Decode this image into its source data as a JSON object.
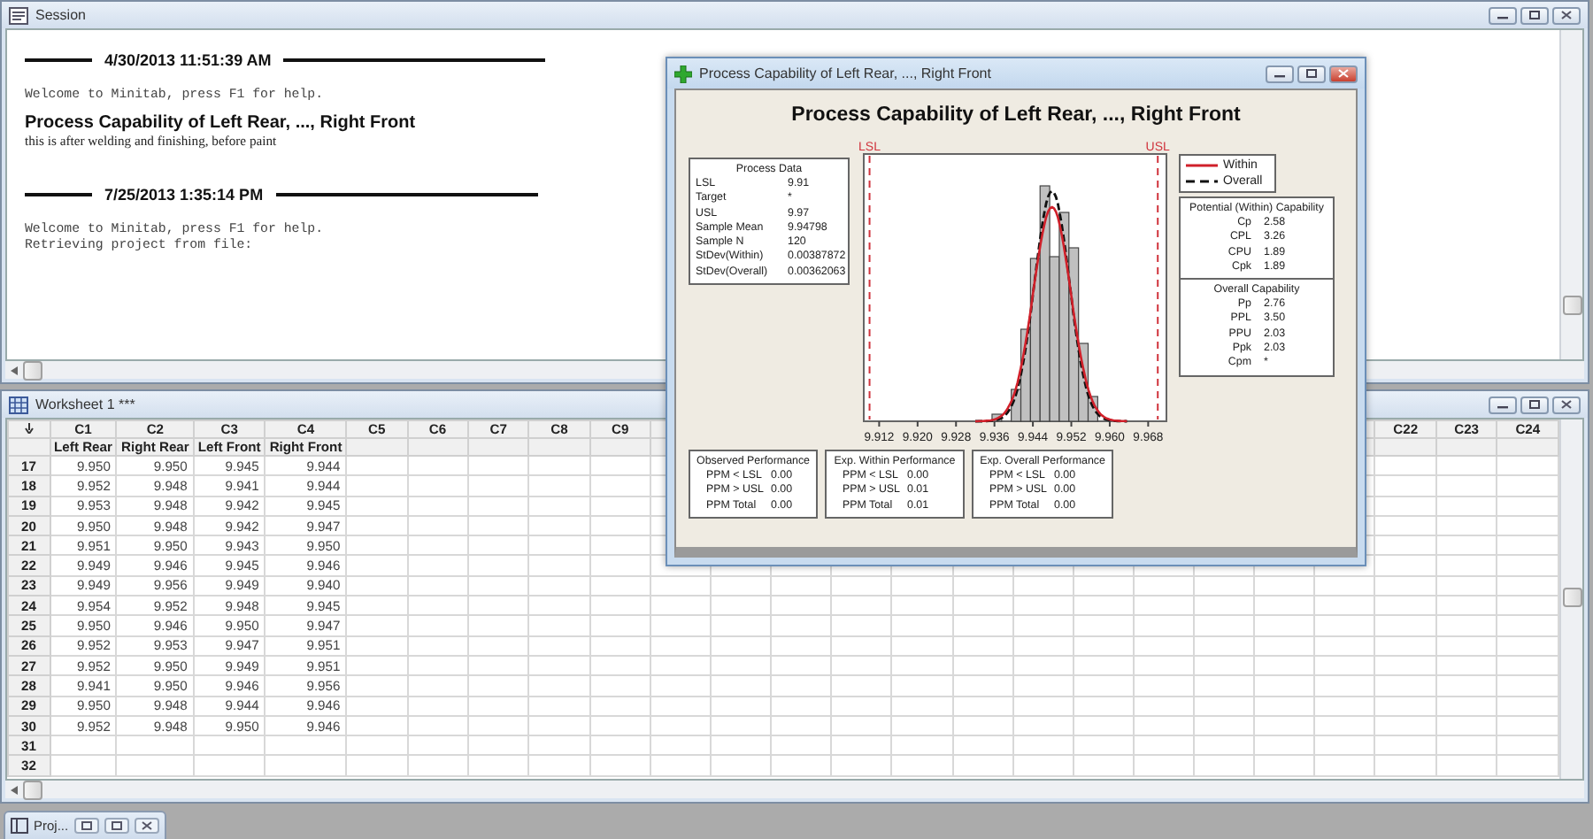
{
  "session": {
    "title": "Session",
    "entries": [
      {
        "kind": "timestamp",
        "text": "4/30/2013 11:51:39 AM"
      },
      {
        "kind": "mono",
        "text": "Welcome to Minitab, press F1 for help."
      },
      {
        "kind": "heading",
        "text": "Process Capability of Left Rear, ..., Right Front"
      },
      {
        "kind": "note",
        "text": "this is after welding and finishing, before paint"
      },
      {
        "kind": "timestamp",
        "text": "7/25/2013 1:35:14 PM"
      },
      {
        "kind": "mono",
        "text": "Welcome to Minitab, press F1 for help."
      },
      {
        "kind": "mono",
        "text": "Retrieving project from file:"
      }
    ]
  },
  "worksheet": {
    "title": "Worksheet 1 ***",
    "columns_left": [
      {
        "label": "C1",
        "name": "Left Rear"
      },
      {
        "label": "C2",
        "name": "Right Rear"
      },
      {
        "label": "C3",
        "name": "Left Front"
      },
      {
        "label": "C4",
        "name": "Right Front"
      },
      {
        "label": "C5"
      },
      {
        "label": "C6"
      },
      {
        "label": "C7"
      },
      {
        "label": "C8"
      },
      {
        "label": "C9"
      }
    ],
    "columns_right": [
      {
        "label": "C22"
      },
      {
        "label": "C23"
      },
      {
        "label": "C24"
      }
    ],
    "rows": [
      {
        "number": "17",
        "cells": [
          "9.950",
          "9.950",
          "9.945",
          "9.944"
        ]
      },
      {
        "number": "18",
        "cells": [
          "9.952",
          "9.948",
          "9.941",
          "9.944"
        ]
      },
      {
        "number": "19",
        "cells": [
          "9.953",
          "9.948",
          "9.942",
          "9.945"
        ]
      },
      {
        "number": "20",
        "cells": [
          "9.950",
          "9.948",
          "9.942",
          "9.947"
        ]
      },
      {
        "number": "21",
        "cells": [
          "9.951",
          "9.950",
          "9.943",
          "9.950"
        ]
      },
      {
        "number": "22",
        "cells": [
          "9.949",
          "9.946",
          "9.945",
          "9.946"
        ]
      },
      {
        "number": "23",
        "cells": [
          "9.949",
          "9.956",
          "9.949",
          "9.940"
        ]
      },
      {
        "number": "24",
        "cells": [
          "9.954",
          "9.952",
          "9.948",
          "9.945"
        ]
      },
      {
        "number": "25",
        "cells": [
          "9.950",
          "9.946",
          "9.950",
          "9.947"
        ]
      },
      {
        "number": "26",
        "cells": [
          "9.952",
          "9.953",
          "9.947",
          "9.951"
        ]
      },
      {
        "number": "27",
        "cells": [
          "9.952",
          "9.950",
          "9.949",
          "9.951"
        ]
      },
      {
        "number": "28",
        "cells": [
          "9.941",
          "9.950",
          "9.946",
          "9.956"
        ]
      },
      {
        "number": "29",
        "cells": [
          "9.950",
          "9.948",
          "9.944",
          "9.946"
        ]
      },
      {
        "number": "30",
        "cells": [
          "9.952",
          "9.948",
          "9.950",
          "9.946"
        ]
      },
      {
        "number": "31",
        "cells": []
      },
      {
        "number": "32",
        "cells": []
      }
    ]
  },
  "capability_window": {
    "title": "Process Capability of Left Rear, ..., Right Front",
    "graph_title": "Process Capability of Left Rear, ..., Right Front",
    "process_data": {
      "title": "Process Data",
      "rows": [
        {
          "label": "LSL",
          "value": "9.91"
        },
        {
          "label": "Target",
          "value": "*"
        },
        {
          "label": "USL",
          "value": "9.97"
        },
        {
          "label": "Sample Mean",
          "value": "9.94798"
        },
        {
          "label": "Sample N",
          "value": "120"
        },
        {
          "label": "StDev(Within)",
          "value": "0.00387872"
        },
        {
          "label": "StDev(Overall)",
          "value": "0.00362063"
        }
      ]
    },
    "spec_labels": [
      "LSL",
      "USL"
    ],
    "x_ticks": [
      "9.912",
      "9.920",
      "9.928",
      "9.936",
      "9.944",
      "9.952",
      "9.960",
      "9.968"
    ],
    "legend": [
      {
        "label": "Within",
        "kind": "solid"
      },
      {
        "label": "Overall",
        "kind": "dashed"
      }
    ],
    "capability_sections": [
      {
        "title": "Potential (Within) Capability",
        "rows": [
          {
            "label": "Cp",
            "value": "2.58"
          },
          {
            "label": "CPL",
            "value": "3.26"
          },
          {
            "label": "CPU",
            "value": "1.89"
          },
          {
            "label": "Cpk",
            "value": "1.89"
          }
        ]
      },
      {
        "title": "Overall Capability",
        "rows": [
          {
            "label": "Pp",
            "value": "2.76"
          },
          {
            "label": "PPL",
            "value": "3.50"
          },
          {
            "label": "PPU",
            "value": "2.03"
          },
          {
            "label": "Ppk",
            "value": "2.03"
          },
          {
            "label": "Cpm",
            "value": "*"
          }
        ]
      }
    ],
    "performance": [
      {
        "title": "Observed Performance",
        "rows": [
          {
            "label": "PPM < LSL",
            "value": "0.00"
          },
          {
            "label": "PPM > USL",
            "value": "0.00"
          },
          {
            "label": "PPM Total",
            "value": "0.00"
          }
        ]
      },
      {
        "title": "Exp. Within Performance",
        "rows": [
          {
            "label": "PPM < LSL",
            "value": "0.00"
          },
          {
            "label": "PPM > USL",
            "value": "0.01"
          },
          {
            "label": "PPM Total",
            "value": "0.01"
          }
        ]
      },
      {
        "title": "Exp. Overall Performance",
        "rows": [
          {
            "label": "PPM < LSL",
            "value": "0.00"
          },
          {
            "label": "PPM > USL",
            "value": "0.00"
          },
          {
            "label": "PPM Total",
            "value": "0.00"
          }
        ]
      }
    ]
  },
  "taskbar": {
    "items": [
      {
        "label": "Proj..."
      }
    ]
  }
}
